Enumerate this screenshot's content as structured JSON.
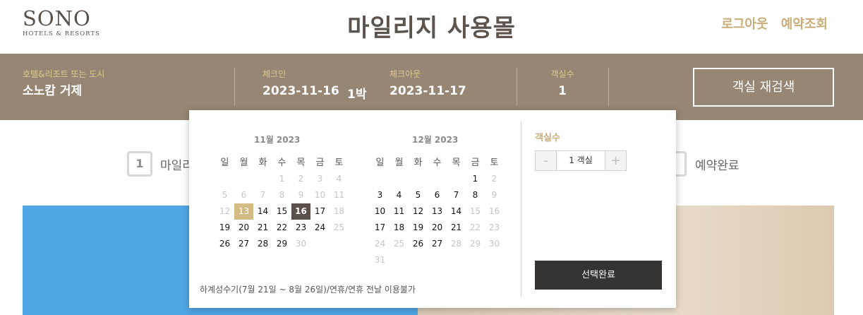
{
  "header": {
    "logo_main": "SONO",
    "logo_sub": "HOTELS & RESORTS",
    "title": "마일리지 사용몰",
    "links": [
      "로그아웃",
      "예약조회"
    ]
  },
  "search": {
    "destination_label": "호텔&리조트 또는 도시",
    "destination_value": "소노캄 거제",
    "checkin_label": "체크인",
    "checkin_value": "2023-11-16",
    "nights": "1박",
    "checkout_label": "체크아웃",
    "checkout_value": "2023-11-17",
    "rooms_label": "객실수",
    "rooms_value": "1",
    "research_button": "객실 재검색"
  },
  "steps": {
    "step1_num": "1",
    "step1_label": "마일리",
    "step_last_label": "예약완료"
  },
  "calendar": {
    "weekdays": [
      "일",
      "월",
      "화",
      "수",
      "목",
      "금",
      "토"
    ],
    "months": [
      {
        "title": "11월 2023",
        "weeks": [
          [
            {
              "d": "",
              "s": "empty"
            },
            {
              "d": "",
              "s": "empty"
            },
            {
              "d": "",
              "s": "empty"
            },
            {
              "d": "1",
              "s": "dim"
            },
            {
              "d": "2",
              "s": "dim"
            },
            {
              "d": "3",
              "s": "dim"
            },
            {
              "d": "4",
              "s": "dim"
            }
          ],
          [
            {
              "d": "5",
              "s": "dim"
            },
            {
              "d": "6",
              "s": "dim"
            },
            {
              "d": "7",
              "s": "dim"
            },
            {
              "d": "8",
              "s": "dim"
            },
            {
              "d": "9",
              "s": "dim"
            },
            {
              "d": "10",
              "s": "dim"
            },
            {
              "d": "11",
              "s": "dim"
            }
          ],
          [
            {
              "d": "12",
              "s": "dim"
            },
            {
              "d": "13",
              "s": "today"
            },
            {
              "d": "14",
              "s": "act"
            },
            {
              "d": "15",
              "s": "act"
            },
            {
              "d": "16",
              "s": "sel"
            },
            {
              "d": "17",
              "s": "act"
            },
            {
              "d": "18",
              "s": "dim"
            }
          ],
          [
            {
              "d": "19",
              "s": "act"
            },
            {
              "d": "20",
              "s": "act"
            },
            {
              "d": "21",
              "s": "act"
            },
            {
              "d": "22",
              "s": "act"
            },
            {
              "d": "23",
              "s": "act"
            },
            {
              "d": "24",
              "s": "act"
            },
            {
              "d": "25",
              "s": "dim"
            }
          ],
          [
            {
              "d": "26",
              "s": "act"
            },
            {
              "d": "27",
              "s": "act"
            },
            {
              "d": "28",
              "s": "act"
            },
            {
              "d": "29",
              "s": "act"
            },
            {
              "d": "30",
              "s": "dim"
            },
            {
              "d": "",
              "s": "empty"
            },
            {
              "d": "",
              "s": "empty"
            }
          ]
        ]
      },
      {
        "title": "12월 2023",
        "weeks": [
          [
            {
              "d": "",
              "s": "empty"
            },
            {
              "d": "",
              "s": "empty"
            },
            {
              "d": "",
              "s": "empty"
            },
            {
              "d": "",
              "s": "empty"
            },
            {
              "d": "",
              "s": "empty"
            },
            {
              "d": "1",
              "s": "act"
            },
            {
              "d": "2",
              "s": "dim"
            }
          ],
          [
            {
              "d": "3",
              "s": "act"
            },
            {
              "d": "4",
              "s": "act"
            },
            {
              "d": "5",
              "s": "act"
            },
            {
              "d": "6",
              "s": "act"
            },
            {
              "d": "7",
              "s": "act"
            },
            {
              "d": "8",
              "s": "act"
            },
            {
              "d": "9",
              "s": "dim"
            }
          ],
          [
            {
              "d": "10",
              "s": "act"
            },
            {
              "d": "11",
              "s": "act"
            },
            {
              "d": "12",
              "s": "act"
            },
            {
              "d": "13",
              "s": "act"
            },
            {
              "d": "14",
              "s": "act"
            },
            {
              "d": "15",
              "s": "dim"
            },
            {
              "d": "16",
              "s": "dim"
            }
          ],
          [
            {
              "d": "17",
              "s": "act"
            },
            {
              "d": "18",
              "s": "act"
            },
            {
              "d": "19",
              "s": "act"
            },
            {
              "d": "20",
              "s": "act"
            },
            {
              "d": "21",
              "s": "act"
            },
            {
              "d": "22",
              "s": "dim"
            },
            {
              "d": "23",
              "s": "dim"
            }
          ],
          [
            {
              "d": "24",
              "s": "dim"
            },
            {
              "d": "25",
              "s": "dim"
            },
            {
              "d": "26",
              "s": "act"
            },
            {
              "d": "27",
              "s": "act"
            },
            {
              "d": "28",
              "s": "dim"
            },
            {
              "d": "29",
              "s": "dim"
            },
            {
              "d": "30",
              "s": "dim"
            }
          ],
          [
            {
              "d": "31",
              "s": "dim"
            },
            {
              "d": "",
              "s": "empty"
            },
            {
              "d": "",
              "s": "empty"
            },
            {
              "d": "",
              "s": "empty"
            },
            {
              "d": "",
              "s": "empty"
            },
            {
              "d": "",
              "s": "empty"
            },
            {
              "d": "",
              "s": "empty"
            }
          ]
        ]
      }
    ],
    "notice": "하계성수기(7월 21일 ~ 8월 26일)/연휴/연휴 전날 이용불가"
  },
  "room_selector": {
    "label": "객실수",
    "minus": "-",
    "value": "1 객실",
    "plus": "+",
    "done_button": "선택완료"
  }
}
